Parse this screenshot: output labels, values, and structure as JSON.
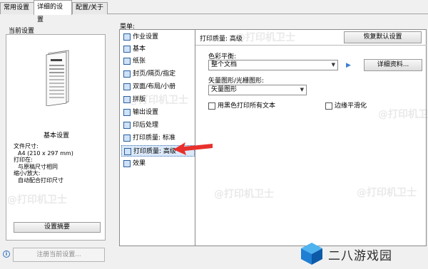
{
  "tabs": [
    "常用设置",
    "详细的设置",
    "配置/关于"
  ],
  "left": {
    "title": "当前设置",
    "basic_title": "基本设置",
    "summary": {
      "paper_label": "文件尺寸:",
      "paper_value": "A4 (210 x 297 mm)",
      "print_on_label": "打印在:",
      "print_on_value": "与原稿尺寸相同",
      "scale_label": "缩小/放大:",
      "scale_value": "自动配合打印尺寸"
    },
    "summary_button": "设置摘要",
    "register_button": "注册当前设置..."
  },
  "menu": {
    "label": "菜单:",
    "items": [
      {
        "label": "作业设置",
        "icon": "job-settings-icon"
      },
      {
        "label": "基本",
        "icon": "basic-icon"
      },
      {
        "label": "纸张",
        "icon": "paper-icon"
      },
      {
        "label": "封页/隔页/指定",
        "icon": "cover-page-icon"
      },
      {
        "label": "双面/布局/小册",
        "icon": "duplex-layout-icon"
      },
      {
        "label": "拼版",
        "icon": "imposition-icon"
      },
      {
        "label": "输出设置",
        "icon": "output-settings-icon"
      },
      {
        "label": "印后处理",
        "icon": "finishing-icon"
      },
      {
        "label": "打印质量: 标准",
        "icon": "print-quality-standard-icon"
      },
      {
        "label": "打印质量: 高级",
        "icon": "print-quality-advanced-icon"
      },
      {
        "label": "效果",
        "icon": "effects-icon"
      }
    ],
    "selected": "打印质量: 高级"
  },
  "panel": {
    "title": "打印质量: 高级",
    "restore_button": "恢复默认设置",
    "color_balance_label": "色彩平衡:",
    "color_balance_value": "整个文档",
    "detail_button": "详细资料...",
    "vector_label": "矢量图形/光栅图形:",
    "vector_value": "矢量图形",
    "black_text_label": "用黑色打印所有文本",
    "black_text_checked": false,
    "smoothing_label": "边缘平滑化",
    "smoothing_checked": false
  },
  "watermark": "@打印机卫士",
  "logo_text": "二八游戏园",
  "colors": {
    "accent_blue": "#3b7fd1",
    "arrow_red": "#e8302c",
    "selection": "#dbe9f9"
  }
}
